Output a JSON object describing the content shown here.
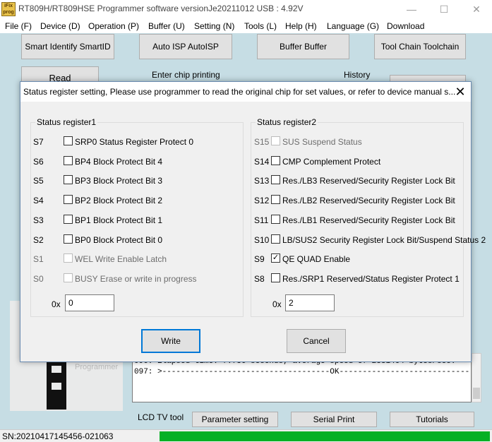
{
  "window": {
    "icon_text": "iFix prog",
    "title": "RT809H/RT809HSE Programmer software versionJe20211012  USB : 4.92V",
    "controls": {
      "minimize": "—",
      "maximize": "☐",
      "close": "✕"
    }
  },
  "menu": [
    "File (F)",
    "Device (D)",
    "Operation (P)",
    "Buffer (U)",
    "Setting (N)",
    "Tools (L)",
    "Help (H)",
    "Language (G)",
    "Download"
  ],
  "toolbar": {
    "smart_identify": "Smart Identify SmartID",
    "auto_isp": "Auto ISP AutoISP",
    "buffer": "Buffer Buffer",
    "toolchain": "Tool Chain Toolchain"
  },
  "main": {
    "read_button": "Read",
    "chip_printing_label": "Enter chip printing",
    "history_label": "History",
    "log_lines": [
      "096:  Elapsed time: 7.756 seconds, average speed of 2551464 bytes/sec.",
      "097:  >------------------------------------OK-------------------------------------<"
    ],
    "bottom_tabs": {
      "lcd": "LCD TV tool",
      "parameter": "Parameter setting",
      "serial": "Serial Print",
      "tutorials": "Tutorials"
    },
    "chip_watermark": "Programmer"
  },
  "statusbar": {
    "serial_number": "SN:20210417145456-021063",
    "progress_percent": 100
  },
  "dialog": {
    "title": "Status register setting, Please use programmer to read the original chip for set values, or refer to device manual s...",
    "close": "✕",
    "group1": {
      "label": "Status register1",
      "rows": [
        {
          "reg": "S7",
          "label": "SRP0 Status Register Protect 0",
          "checked": false,
          "disabled": false
        },
        {
          "reg": "S6",
          "label": "BP4  Block Protect Bit 4",
          "checked": false,
          "disabled": false
        },
        {
          "reg": "S5",
          "label": "BP3  Block Protect Bit 3",
          "checked": false,
          "disabled": false
        },
        {
          "reg": "S4",
          "label": "BP2  Block Protect Bit 2",
          "checked": false,
          "disabled": false
        },
        {
          "reg": "S3",
          "label": "BP1  Block Protect Bit 1",
          "checked": false,
          "disabled": false
        },
        {
          "reg": "S2",
          "label": "BP0  Block Protect Bit 0",
          "checked": false,
          "disabled": false
        },
        {
          "reg": "S1",
          "label": "WEL  Write Enable Latch",
          "checked": false,
          "disabled": true
        },
        {
          "reg": "S0",
          "label": "BUSY Erase or write in progress",
          "checked": false,
          "disabled": true
        }
      ],
      "hex_label": "0x",
      "hex_value": "0"
    },
    "group2": {
      "label": "Status register2",
      "rows": [
        {
          "reg": "S15",
          "label": "SUS  Suspend Status",
          "checked": false,
          "disabled": true
        },
        {
          "reg": "S14",
          "label": "CMP  Complement Protect",
          "checked": false,
          "disabled": false
        },
        {
          "reg": "S13",
          "label": "Res./LB3  Reserved/Security Register Lock Bit",
          "checked": false,
          "disabled": false
        },
        {
          "reg": "S12",
          "label": "Res./LB2  Reserved/Security Register Lock Bit",
          "checked": false,
          "disabled": false
        },
        {
          "reg": "S11",
          "label": "Res./LB1  Reserved/Security Register Lock Bit",
          "checked": false,
          "disabled": false
        },
        {
          "reg": "S10",
          "label": "LB/SUS2 Security Register Lock Bit/Suspend Status 2",
          "checked": false,
          "disabled": false
        },
        {
          "reg": "S9",
          "label": "QE    QUAD Enable",
          "checked": true,
          "disabled": false
        },
        {
          "reg": "S8",
          "label": "Res./SRP1 Reserved/Status Register Protect 1",
          "checked": false,
          "disabled": false
        }
      ],
      "hex_label": "0x",
      "hex_value": "2"
    },
    "write_button": "Write",
    "cancel_button": "Cancel"
  }
}
